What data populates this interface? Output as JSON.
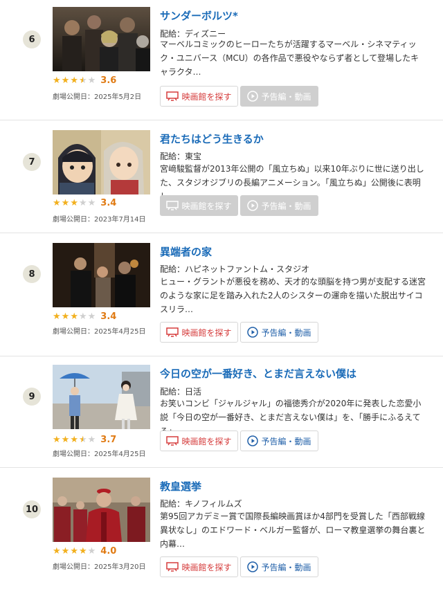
{
  "colors": {
    "link": "#1a6bb8",
    "star": "#f2b01e",
    "score": "#e07b14",
    "theater": "#d53b3b",
    "trailer": "#1f5fa8"
  },
  "buttons": {
    "theater_label": "映画館を探す",
    "trailer_label": "予告編・動画"
  },
  "icons": {
    "theater": "theater-screen-icon",
    "trailer": "play-circle-icon"
  },
  "items": [
    {
      "rank": "6",
      "title": "サンダーボルツ*",
      "distributor": "配給：ディズニー",
      "description": "マーベルコミックのヒーローたちが活躍するマーベル・シネマティック・ユニバース（MCU）の各作品で悪役やならず者として登場したキャラクタ…",
      "rating": 3.6,
      "rating_label": "3.6",
      "release": "劇場公開日：2025年5月2日",
      "theater_enabled": true,
      "trailer_enabled": false
    },
    {
      "rank": "7",
      "title": "君たちはどう生きるか",
      "distributor": "配給：東宝",
      "description": "宮﨑駿監督が2013年公開の「風立ちぬ」以来10年ぶりに世に送り出した、スタジオジブリの長編アニメーション。「風立ちぬ」公開後に表明し…",
      "rating": 3.4,
      "rating_label": "3.4",
      "release": "劇場公開日：2023年7月14日",
      "theater_enabled": false,
      "trailer_enabled": false
    },
    {
      "rank": "8",
      "title": "異端者の家",
      "distributor": "配給：ハピネットファントム・スタジオ",
      "description": "ヒュー・グラントが悪役を務め、天才的な頭脳を持つ男が支配する迷宮のような家に足を踏み入れた2人のシスターの運命を描いた脱出サイコスリラ…",
      "rating": 3.4,
      "rating_label": "3.4",
      "release": "劇場公開日：2025年4月25日",
      "theater_enabled": true,
      "trailer_enabled": true
    },
    {
      "rank": "9",
      "title": "今日の空が一番好き、とまだ言えない僕は",
      "distributor": "配給：日活",
      "description": "お笑いコンビ「ジャルジャル」の福徳秀介が2020年に発表した恋愛小説「今日の空が一番好き、とまだ言えない僕は」を、「勝手にふるえてろ」…",
      "rating": 3.7,
      "rating_label": "3.7",
      "release": "劇場公開日：2025年4月25日",
      "theater_enabled": true,
      "trailer_enabled": true
    },
    {
      "rank": "10",
      "title": "教皇選挙",
      "distributor": "配給：キノフィルムズ",
      "description": "第95回アカデミー賞で国際長編映画賞ほか4部門を受賞した「西部戦線異状なし」のエドワード・ベルガー監督が、ローマ教皇選挙の舞台裏と内幕…",
      "rating": 4.0,
      "rating_label": "4.0",
      "release": "劇場公開日：2025年3月20日",
      "theater_enabled": true,
      "trailer_enabled": true
    }
  ]
}
